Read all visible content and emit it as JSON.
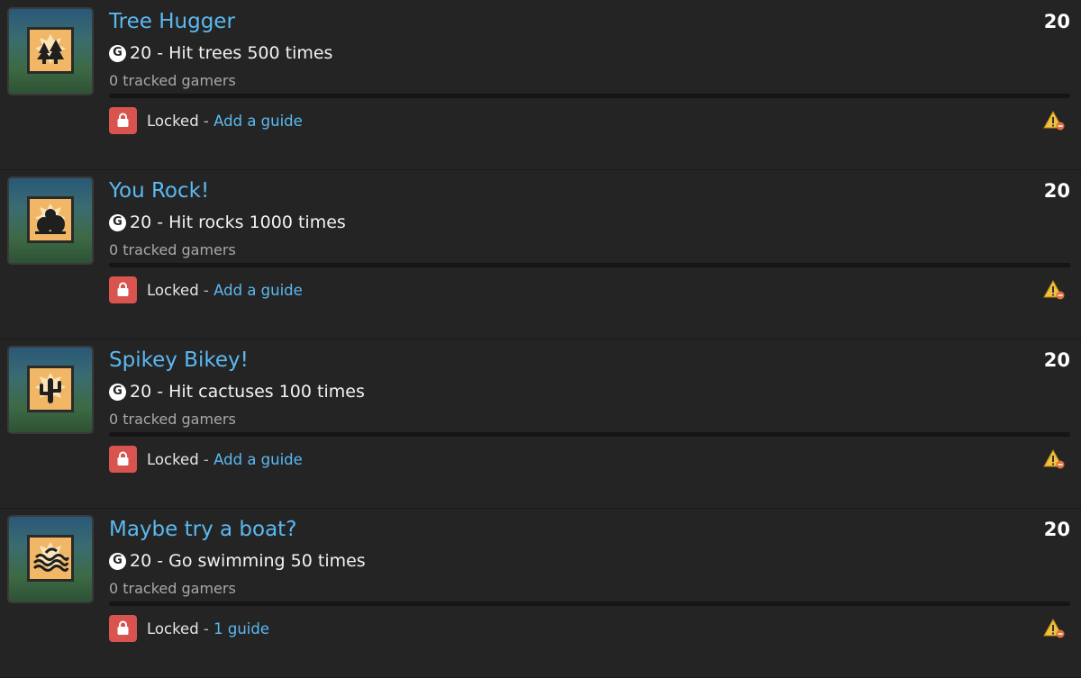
{
  "achievements": [
    {
      "title": "Tree Hugger",
      "gamerscore": "20",
      "description": "20 - Hit trees 500 times",
      "tracked": "0 tracked gamers",
      "status": "Locked",
      "separator": " - ",
      "guide_label": "Add a guide",
      "points": "20",
      "icon": "tree-icon"
    },
    {
      "title": "You Rock!",
      "gamerscore": "20",
      "description": "20 - Hit rocks 1000 times",
      "tracked": "0 tracked gamers",
      "status": "Locked",
      "separator": " - ",
      "guide_label": "Add a guide",
      "points": "20",
      "icon": "rocks-icon"
    },
    {
      "title": "Spikey Bikey!",
      "gamerscore": "20",
      "description": "20 - Hit cactuses 100 times",
      "tracked": "0 tracked gamers",
      "status": "Locked",
      "separator": " - ",
      "guide_label": "Add a guide",
      "points": "20",
      "icon": "cactus-icon"
    },
    {
      "title": "Maybe try a boat?",
      "gamerscore": "20",
      "description": "20 - Go swimming 50 times",
      "tracked": "0 tracked gamers",
      "status": "Locked",
      "separator": " - ",
      "guide_label": "1 guide",
      "points": "20",
      "icon": "waves-icon"
    }
  ],
  "gamerscore_glyph": "G",
  "colors": {
    "background": "#242424",
    "link": "#5bb9f1",
    "locked": "#d9534f",
    "warning": "#f0c040"
  }
}
